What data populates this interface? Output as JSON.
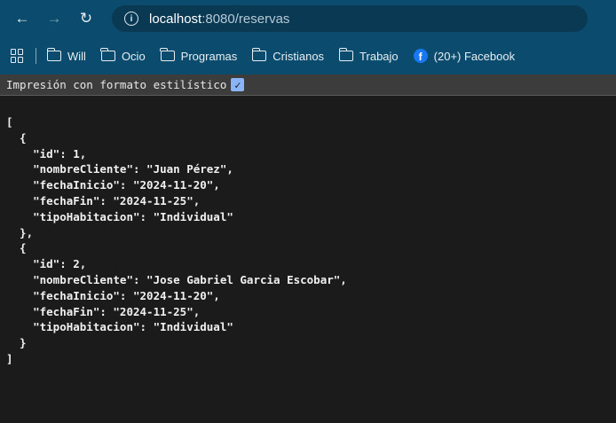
{
  "toolbar": {
    "back_icon": "back-arrow-icon",
    "back_glyph": "←",
    "forward_glyph": "→",
    "reload_glyph": "↻",
    "info_glyph": "i",
    "url_host": "localhost",
    "url_rest": ":8080/reservas"
  },
  "bookmarks": {
    "items": [
      "Will",
      "Ocio",
      "Programas",
      "Cristianos",
      "Trabajo"
    ],
    "facebook_label": "(20+) Facebook",
    "facebook_glyph": "f"
  },
  "pretty_print": {
    "label": "Impresión con formato estilístico",
    "checked_glyph": "✓"
  },
  "colors": {
    "toolbar_bg": "#0b4b6d",
    "content_bg": "#1b1b1b",
    "checkbox": "#8ab4f8"
  },
  "json_lines": [
    "[",
    "  {",
    "    \"id\": 1,",
    "    \"nombreCliente\": \"Juan Pérez\",",
    "    \"fechaInicio\": \"2024-11-20\",",
    "    \"fechaFin\": \"2024-11-25\",",
    "    \"tipoHabitacion\": \"Individual\"",
    "  },",
    "  {",
    "    \"id\": 2,",
    "    \"nombreCliente\": \"Jose Gabriel Garcia Escobar\",",
    "    \"fechaInicio\": \"2024-11-20\",",
    "    \"fechaFin\": \"2024-11-25\",",
    "    \"tipoHabitacion\": \"Individual\"",
    "  }",
    "]"
  ]
}
